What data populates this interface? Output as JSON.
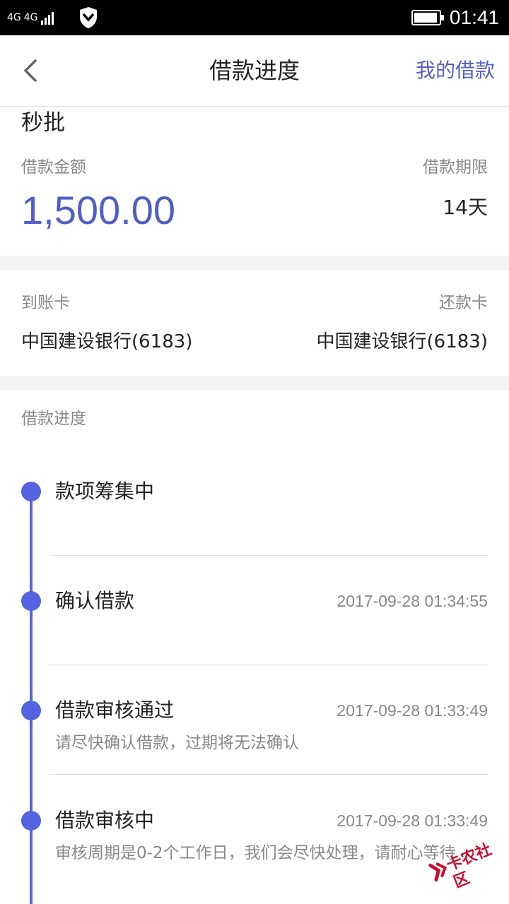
{
  "status_bar": {
    "network_left": "4G",
    "network_right": "4G",
    "time": "01:41",
    "battery_level": 0.95,
    "shield_icon": "shield-icon",
    "color": "#000000"
  },
  "nav": {
    "back_icon": "chevron-left-icon",
    "title": "借款进度",
    "right_link": "我的借款",
    "accent_color": "#5360c8"
  },
  "loan": {
    "product_name": "秒批",
    "amount_label": "借款金额",
    "amount": "1,500.00",
    "term_label": "借款期限",
    "term": "14天"
  },
  "bank": {
    "receive_label": "到账卡",
    "receive_card": "中国建设银行(6183)",
    "repay_label": "还款卡",
    "repay_card": "中国建设银行(6183)"
  },
  "progress": {
    "title": "借款进度",
    "timeline_color": "#5464e1",
    "steps": [
      {
        "title": "款项筹集中",
        "time": "",
        "desc": ""
      },
      {
        "title": "确认借款",
        "time": "2017-09-28 01:34:55",
        "desc": ""
      },
      {
        "title": "借款审核通过",
        "time": "2017-09-28 01:33:49",
        "desc": "请尽快确认借款，过期将无法确认"
      },
      {
        "title": "借款审核中",
        "time": "2017-09-28 01:33:49",
        "desc": "审核周期是0-2个工作日，我们会尽快处理，请耐心等待"
      }
    ]
  },
  "watermark": {
    "text": "卡农社区"
  }
}
